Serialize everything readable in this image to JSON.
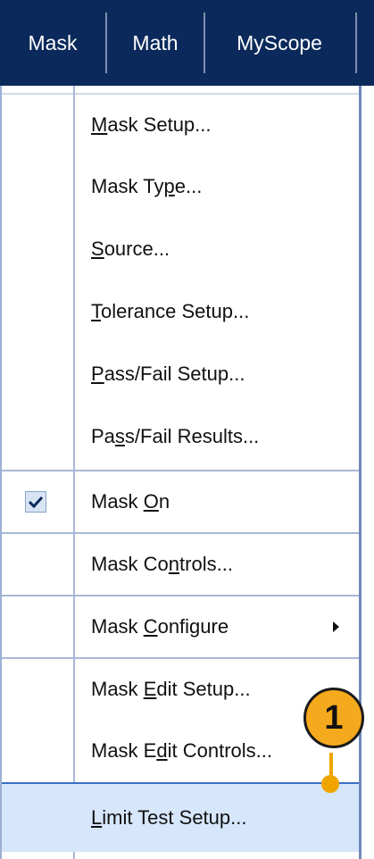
{
  "menubar": {
    "items": [
      {
        "label": "Mask"
      },
      {
        "label": "Math"
      },
      {
        "label": "MyScope"
      }
    ]
  },
  "menu": {
    "items": [
      {
        "pre": "",
        "u": "M",
        "post": "ask Setup..."
      },
      {
        "pre": "Mask Ty",
        "u": "p",
        "post": "e..."
      },
      {
        "pre": "",
        "u": "S",
        "post": "ource..."
      },
      {
        "pre": "",
        "u": "T",
        "post": "olerance Setup..."
      },
      {
        "pre": "",
        "u": "P",
        "post": "ass/Fail Setup..."
      },
      {
        "pre": "Pa",
        "u": "s",
        "post": "s/Fail Results..."
      },
      {
        "pre": "Mask ",
        "u": "O",
        "post": "n",
        "checked": true
      },
      {
        "pre": "Mask Co",
        "u": "n",
        "post": "trols..."
      },
      {
        "pre": "Mask ",
        "u": "C",
        "post": "onfigure",
        "submenu": true
      },
      {
        "pre": "Mask ",
        "u": "E",
        "post": "dit Setup..."
      },
      {
        "pre": "Mask E",
        "u": "d",
        "post": "it Controls..."
      },
      {
        "pre": "",
        "u": "L",
        "post": "imit Test Setup...",
        "highlighted": true
      }
    ]
  },
  "callout": {
    "label": "1"
  },
  "colors": {
    "menubar": "#0b2a5b",
    "highlight": "#d6e6fb",
    "callout": "#f5a91c"
  }
}
